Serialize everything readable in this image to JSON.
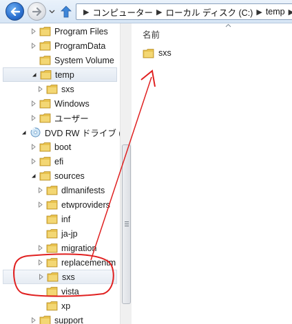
{
  "address_bar": {
    "parts": [
      "コンピューター",
      "ローカル ディスク (C:)",
      "temp"
    ]
  },
  "tree": {
    "items": [
      {
        "label": "Program Files",
        "indent": 1,
        "chevron": "collapsed",
        "state": ""
      },
      {
        "label": "ProgramData",
        "indent": 1,
        "chevron": "collapsed",
        "state": ""
      },
      {
        "label": "System Volume",
        "indent": 1,
        "chevron": "none",
        "state": ""
      },
      {
        "label": "temp",
        "indent": 1,
        "chevron": "expanded",
        "state": "current"
      },
      {
        "label": "sxs",
        "indent": 2,
        "chevron": "collapsed",
        "state": ""
      },
      {
        "label": "Windows",
        "indent": 1,
        "chevron": "collapsed",
        "state": ""
      },
      {
        "label": "ユーザー",
        "indent": 1,
        "chevron": "collapsed",
        "state": ""
      },
      {
        "label": "DVD RW ドライブ (D",
        "indent": 0,
        "chevron": "expanded",
        "state": "",
        "icon": "dvd"
      },
      {
        "label": "boot",
        "indent": 1,
        "chevron": "collapsed",
        "state": ""
      },
      {
        "label": "efi",
        "indent": 1,
        "chevron": "collapsed",
        "state": ""
      },
      {
        "label": "sources",
        "indent": 1,
        "chevron": "expanded",
        "state": ""
      },
      {
        "label": "dlmanifests",
        "indent": 2,
        "chevron": "collapsed",
        "state": ""
      },
      {
        "label": "etwproviders",
        "indent": 2,
        "chevron": "collapsed",
        "state": ""
      },
      {
        "label": "inf",
        "indent": 2,
        "chevron": "none",
        "state": ""
      },
      {
        "label": "ja-jp",
        "indent": 2,
        "chevron": "none",
        "state": ""
      },
      {
        "label": "migration",
        "indent": 2,
        "chevron": "collapsed",
        "state": ""
      },
      {
        "label": "replacementm",
        "indent": 2,
        "chevron": "collapsed",
        "state": ""
      },
      {
        "label": "sxs",
        "indent": 2,
        "chevron": "collapsed",
        "state": "selected"
      },
      {
        "label": "vista",
        "indent": 2,
        "chevron": "none",
        "state": ""
      },
      {
        "label": "xp",
        "indent": 2,
        "chevron": "none",
        "state": ""
      },
      {
        "label": "support",
        "indent": 1,
        "chevron": "collapsed",
        "state": ""
      }
    ]
  },
  "content": {
    "column_header": "名前",
    "items": [
      {
        "label": "sxs",
        "icon": "folder-icon"
      }
    ]
  },
  "colors": {
    "folder": "#e8c24f",
    "annotation": "#e02020",
    "nav_back": "#2a6fcf"
  },
  "icons": {
    "back": "back-arrow-icon",
    "forward": "forward-arrow-icon",
    "up": "up-arrow-icon",
    "folder": "folder-icon",
    "dvd": "dvd-drive-icon"
  }
}
